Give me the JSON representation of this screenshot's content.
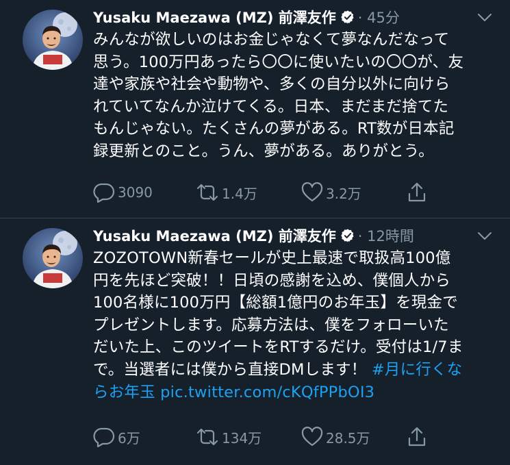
{
  "colors": {
    "background": "#15202b",
    "text": "#ffffff",
    "secondary": "#8899a6",
    "link": "#1da1f2",
    "divider": "#38444d"
  },
  "tweets": [
    {
      "name": "Yusaku Maezawa (MZ) 前澤友作",
      "verified_icon": "verified-badge-icon",
      "time": "· 45分",
      "text_lines": [
        "みんなが欲しいのはお金じゃなくて夢なんだなって",
        "思う。100万円あったら〇〇に使いたいの〇〇が、友",
        "達や家族や社会や動物や、多くの自分以外に向けら",
        "れていてなんか泣けてくる。日本、まだまだ捨てた",
        "もんじゃない。たくさんの夢がある。RT数が日本記",
        "録更新とのこと。うん、夢がある。ありがとう。"
      ],
      "replies": "3090",
      "retweets": "1.4万",
      "likes": "3.2万"
    },
    {
      "name": "Yusaku Maezawa (MZ) 前澤友作",
      "verified_icon": "verified-badge-icon",
      "time": "· 12時間",
      "text_lines": [
        "ZOZOTOWN新春セールが史上最速で取扱高100億",
        "円を先ほど突破！！日頃の感謝を込め、僕個人から",
        "100名様に100万円【総額1億円のお年玉】を現金で",
        "プレゼントします。応募方法は、僕をフォローいた",
        "だいた上、このツイートをRTするだけ。受付は1/7ま",
        "で。当選者には僕から直接DMします！"
      ],
      "hashtag_part1": "#月に行くな",
      "hashtag_part2": "らお年玉",
      "link": "pic.twitter.com/cKQfPPbOI3",
      "replies": "6万",
      "retweets": "134万",
      "likes": "28.5万"
    }
  ]
}
